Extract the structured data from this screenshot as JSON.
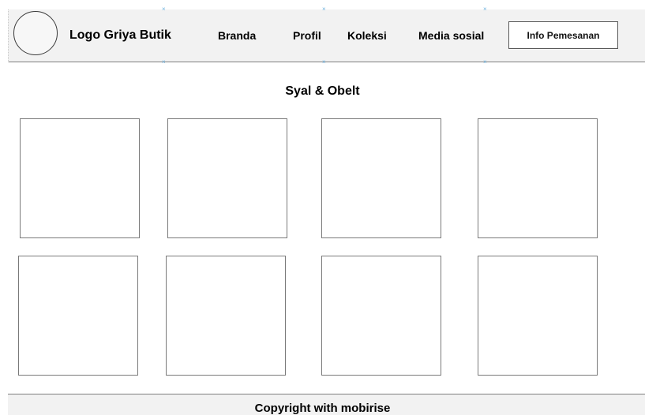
{
  "header": {
    "logo_text": "Logo Griya Butik",
    "nav": [
      {
        "label": "Branda"
      },
      {
        "label": "Profil"
      },
      {
        "label": "Koleksi"
      },
      {
        "label": "Media sosial"
      }
    ],
    "order_button": "Info Pemesanan"
  },
  "main": {
    "section_title": "Syal & Obelt",
    "product_tiles": 8
  },
  "footer": {
    "text": "Copyright with mobirise"
  },
  "colors": {
    "header_background": "#f2f2f2",
    "border": "#7f7f7f",
    "marker": "#6fb3e0"
  }
}
